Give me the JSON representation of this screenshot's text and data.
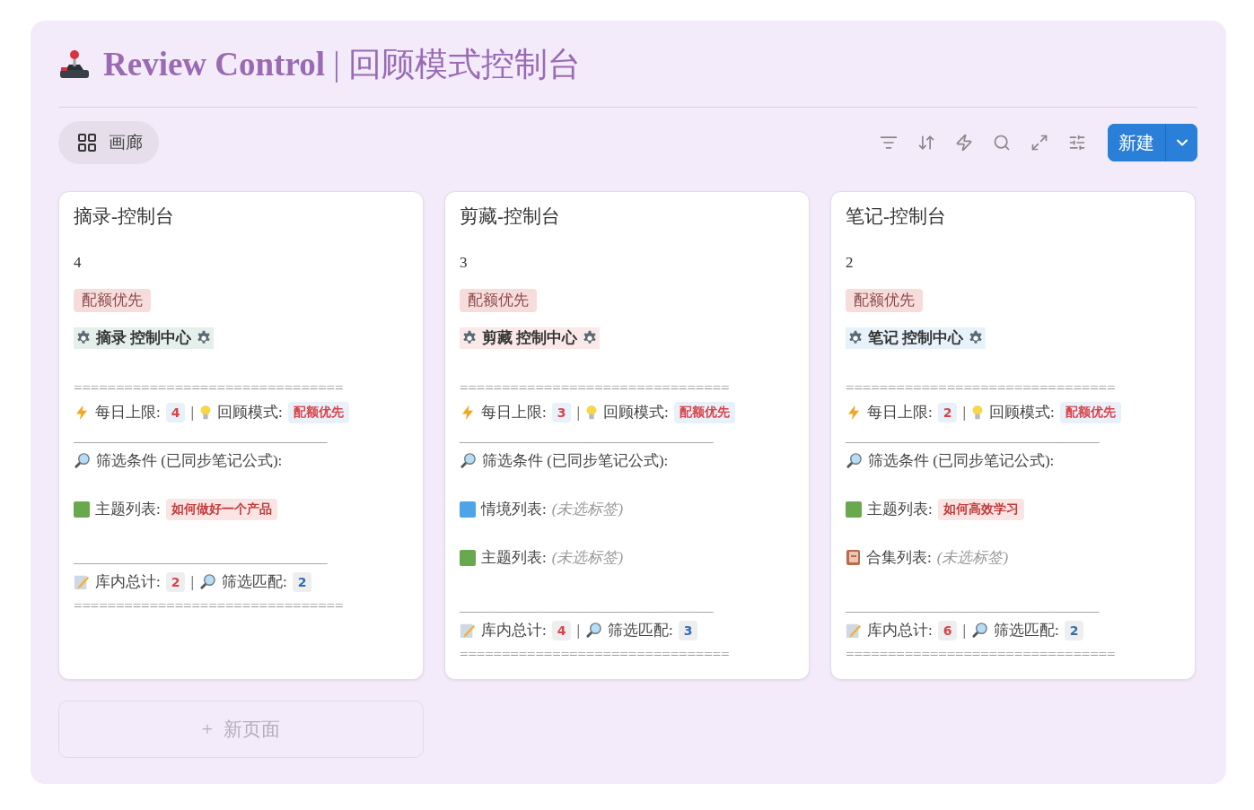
{
  "title": "**Review Control** | 回顾模式控制台",
  "view_button": {
    "label": "画廊"
  },
  "new_button": {
    "label": "新建"
  },
  "cards": [
    {
      "title": "摘录-控制台",
      "count": "4",
      "tag": "配额优先",
      "heading": "摘录 控制中心",
      "color": "#e5efec",
      "rule_top": "================================",
      "limit_label": "每日上限:",
      "limit": "4",
      "separator_1": "|",
      "mode_label": "回顾模式:",
      "mode": "配额优先",
      "rule_mid": "__________________________________",
      "filter_header": "筛选条件 (已同步笔记公式):",
      "filters": [
        {
          "kind": "square",
          "color": "#6aa84f",
          "label": "主题列表:",
          "value": "如何做好一个产品",
          "empty": false
        }
      ],
      "rule_low": "__________________________________",
      "total_label": "库内总计:",
      "total": "2",
      "separator_2": "|",
      "match_label": "筛选匹配:",
      "match": "2",
      "rule_bottom": "================================"
    },
    {
      "title": "剪藏-控制台",
      "count": "3",
      "tag": "配额优先",
      "heading": "剪藏 控制中心",
      "color": "#fbe9ea",
      "rule_top": "================================",
      "limit_label": "每日上限:",
      "limit": "3",
      "separator_1": "|",
      "mode_label": "回顾模式:",
      "mode": "配额优先",
      "rule_mid": "__________________________________",
      "filter_header": "筛选条件 (已同步笔记公式):",
      "filters": [
        {
          "kind": "square",
          "color": "#4fa3e8",
          "label": "情境列表:",
          "value": "(未选标签)",
          "empty": true
        },
        {
          "kind": "square",
          "color": "#6aa84f",
          "label": "主题列表:",
          "value": "(未选标签)",
          "empty": true
        }
      ],
      "rule_low": "__________________________________",
      "total_label": "库内总计:",
      "total": "4",
      "separator_2": "|",
      "match_label": "筛选匹配:",
      "match": "3",
      "rule_bottom": "================================"
    },
    {
      "title": "笔记-控制台",
      "count": "2",
      "tag": "配额优先",
      "heading": "笔记 控制中心",
      "color": "#e8f2fb",
      "rule_top": "================================",
      "limit_label": "每日上限:",
      "limit": "2",
      "separator_1": "|",
      "mode_label": "回顾模式:",
      "mode": "配额优先",
      "rule_mid": "__________________________________",
      "filter_header": "筛选条件 (已同步笔记公式):",
      "filters": [
        {
          "kind": "square",
          "color": "#6aa84f",
          "label": "主题列表:",
          "value": "如何高效学习",
          "empty": false
        },
        {
          "kind": "book",
          "label": "合集列表:",
          "value": "(未选标签)",
          "empty": true
        }
      ],
      "rule_low": "__________________________________",
      "total_label": "库内总计:",
      "total": "6",
      "separator_2": "|",
      "match_label": "筛选匹配:",
      "match": "2",
      "rule_bottom": "================================"
    }
  ],
  "new_page": {
    "plus": "+",
    "label": "新页面"
  }
}
